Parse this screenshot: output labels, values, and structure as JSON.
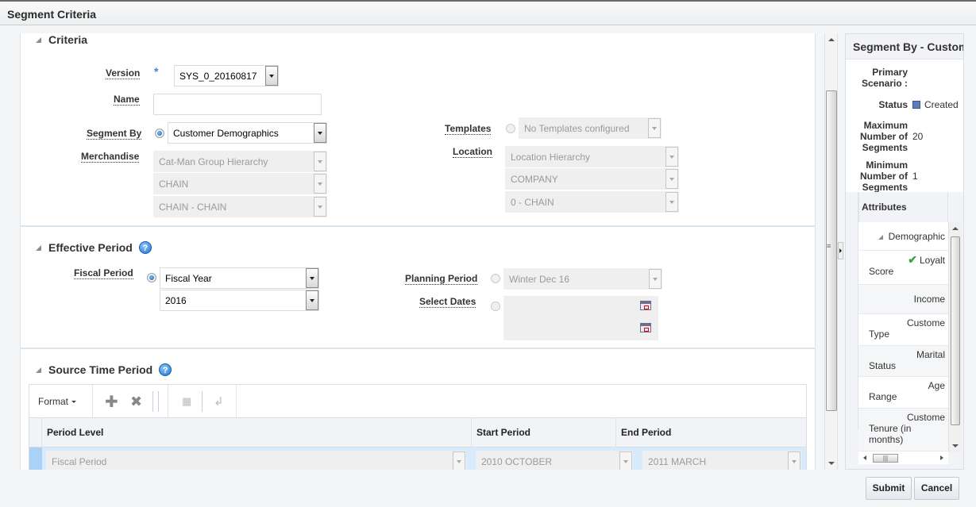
{
  "window": {
    "title": "Segment Criteria"
  },
  "criteria": {
    "section_title": "Criteria",
    "version": {
      "label": "Version",
      "required": "*",
      "value": "SYS_0_20160817"
    },
    "name": {
      "label": "Name",
      "value": ""
    },
    "segment_by": {
      "label": "Segment By",
      "value": "Customer Demographics",
      "selected": true
    },
    "merchandise": {
      "label": "Merchandise",
      "values": [
        "Cat-Man Group Hierarchy",
        "CHAIN",
        "CHAIN - CHAIN"
      ]
    },
    "templates": {
      "label": "Templates",
      "value": "No Templates configured"
    },
    "location": {
      "label": "Location",
      "values": [
        "Location Hierarchy",
        "COMPANY",
        "0 - CHAIN"
      ]
    }
  },
  "effective_period": {
    "section_title": "Effective Period",
    "help": "?",
    "fiscal_period": {
      "label": "Fiscal Period",
      "type_value": "Fiscal Year",
      "year_value": "2016",
      "selected": true
    },
    "planning_period": {
      "label": "Planning Period",
      "value": "Winter Dec 16"
    },
    "select_dates": {
      "label": "Select Dates"
    }
  },
  "source_time_period": {
    "section_title": "Source Time Period",
    "help": "?",
    "toolbar": {
      "format_label": "Format",
      "add_icon": "plus-icon",
      "delete_icon": "x-icon",
      "freeze_icon": "columns-icon",
      "wrap_icon": "wrap-icon"
    },
    "columns": [
      "Period Level",
      "Start Period",
      "End Period"
    ],
    "rows": [
      {
        "period_level": "Fiscal Period",
        "start_period": "2010 OCTOBER",
        "end_period": "2011 MARCH"
      }
    ]
  },
  "side_panel": {
    "title": "Segment By - Customer Demographics",
    "properties": [
      {
        "label": "Primary Scenario :",
        "value": ""
      },
      {
        "label": "Status",
        "value": "Created"
      },
      {
        "label": "Maximum Number of Segments",
        "value": "20"
      },
      {
        "label": "Minimum Number of Segments",
        "value": "1"
      }
    ],
    "status_color": "#5b7cbf",
    "attributes_header": "Attributes",
    "attributes": [
      {
        "line1": "Demographic",
        "line2": "",
        "group": true
      },
      {
        "line1": "Loyalt",
        "line2": "Score",
        "checked": true
      },
      {
        "line1": "Income",
        "line2": ""
      },
      {
        "line1": "Custome",
        "line2": "Type"
      },
      {
        "line1": "Marital",
        "line2": "Status"
      },
      {
        "line1": "Age",
        "line2": "Range"
      },
      {
        "line1": "Custome",
        "line2": "Tenure (in months)"
      }
    ]
  },
  "footer": {
    "submit_label": "Submit",
    "cancel_label": "Cancel"
  }
}
